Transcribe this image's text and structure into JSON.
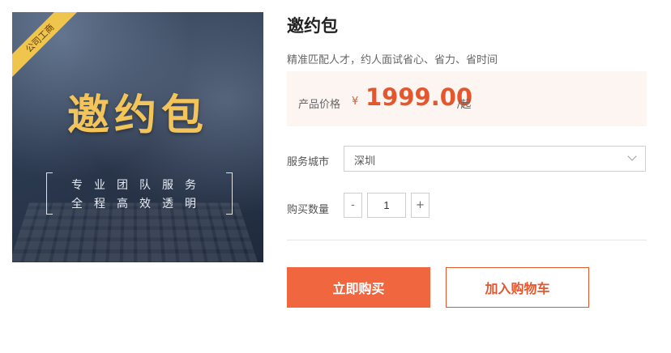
{
  "product_image": {
    "corner_badge": "公司工商",
    "headline": "邀约包",
    "slogan_line1": "专业团队服务",
    "slogan_line2": "全程高效透明",
    "accent_color": "#f3c459"
  },
  "product": {
    "name": "邀约包",
    "description": "精准匹配人才，约人面试省心、省力、省时间"
  },
  "price": {
    "label": "产品价格",
    "currency": "¥",
    "value": "1999.00",
    "unit": "/起",
    "color": "#e4572e"
  },
  "city": {
    "label": "服务城市",
    "selected": "深圳",
    "icon": "chevron-down-icon"
  },
  "quantity": {
    "label": "购买数量",
    "minus": "-",
    "value": "1",
    "plus": "+"
  },
  "actions": {
    "buy_now": "立即购买",
    "add_to_cart": "加入购物车",
    "primary_color": "#f0663f"
  }
}
